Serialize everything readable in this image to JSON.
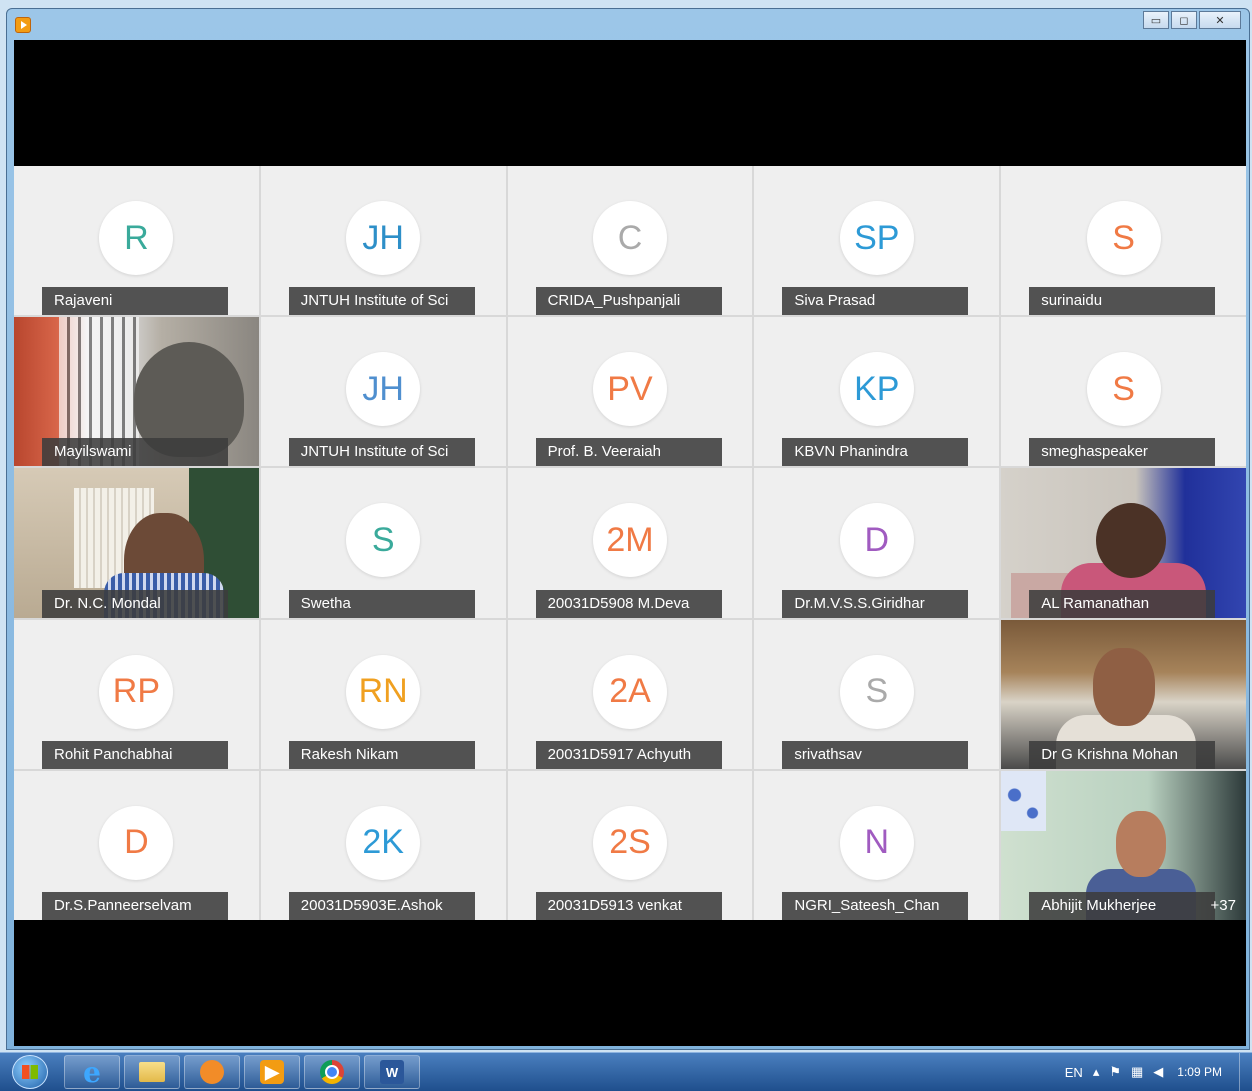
{
  "participants": [
    {
      "initials": "R",
      "name": "Rajaveni",
      "color": "#3aaa9b"
    },
    {
      "initials": "JH",
      "name": "JNTUH Institute of Sci",
      "color": "#2d8fc8"
    },
    {
      "initials": "C",
      "name": "CRIDA_Pushpanjali",
      "color": "#aaaaaa"
    },
    {
      "initials": "SP",
      "name": "Siva Prasad",
      "color": "#2d9ad6"
    },
    {
      "initials": "S",
      "name": "surinaidu",
      "color": "#f07a45"
    },
    {
      "initials": "",
      "name": "Mayilswami",
      "color": "#ffffff"
    },
    {
      "initials": "JH",
      "name": "JNTUH Institute of Sci",
      "color": "#4f8fcf"
    },
    {
      "initials": "PV",
      "name": "Prof. B. Veeraiah",
      "color": "#f07a45"
    },
    {
      "initials": "KP",
      "name": "KBVN Phanindra",
      "color": "#2d9ad6"
    },
    {
      "initials": "S",
      "name": "smeghaspeaker",
      "color": "#f07a45"
    },
    {
      "initials": "",
      "name": "Dr. N.C. Mondal",
      "color": "#ffffff"
    },
    {
      "initials": "S",
      "name": "Swetha",
      "color": "#3aaa9b"
    },
    {
      "initials": "2M",
      "name": "20031D5908 M.Deva",
      "color": "#f07a45"
    },
    {
      "initials": "D",
      "name": "Dr.M.V.S.S.Giridhar",
      "color": "#a05bc0"
    },
    {
      "initials": "",
      "name": "AL Ramanathan",
      "color": "#ffffff"
    },
    {
      "initials": "RP",
      "name": "Rohit Panchabhai",
      "color": "#f07a45"
    },
    {
      "initials": "RN",
      "name": "Rakesh Nikam",
      "color": "#f0a020"
    },
    {
      "initials": "2A",
      "name": "20031D5917 Achyuth",
      "color": "#f07a45"
    },
    {
      "initials": "S",
      "name": "srivathsav",
      "color": "#aaaaaa"
    },
    {
      "initials": "",
      "name": "Dr G Krishna Mohan",
      "color": "#ffffff"
    },
    {
      "initials": "D",
      "name": "Dr.S.Panneerselvam",
      "color": "#f07a45"
    },
    {
      "initials": "2K",
      "name": "20031D5903E.Ashok",
      "color": "#2d9ad6"
    },
    {
      "initials": "2S",
      "name": "20031D5913 venkat",
      "color": "#f07a45"
    },
    {
      "initials": "N",
      "name": "NGRI_Sateesh_Chan",
      "color": "#a05bc0"
    },
    {
      "initials": "",
      "name": "Abhijit Mukherjee",
      "color": "#ffffff"
    }
  ],
  "more_count": "+37",
  "taskbar": {
    "tray_lang": "EN",
    "time": "1:09 PM"
  },
  "window": {
    "minimize": "▭",
    "maximize": "◻",
    "close": "✕"
  }
}
